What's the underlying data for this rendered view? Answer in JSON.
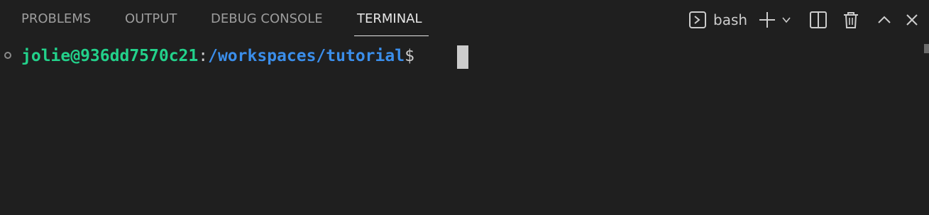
{
  "tabs": [
    {
      "label": "PROBLEMS",
      "active": false
    },
    {
      "label": "OUTPUT",
      "active": false
    },
    {
      "label": "DEBUG CONSOLE",
      "active": false
    },
    {
      "label": "TERMINAL",
      "active": true
    }
  ],
  "toolbar": {
    "shell_label": "bash",
    "icons": [
      "terminal-icon",
      "plus-icon",
      "chevron-down-icon",
      "split-icon",
      "trash-icon",
      "chevron-up-icon",
      "close-icon"
    ]
  },
  "terminal": {
    "user_host": "jolie@936dd7570c21",
    "separator": ":",
    "path": "/workspaces/tutorial",
    "prompt_symbol": "$"
  },
  "colors": {
    "background": "#1f1f1f",
    "user_host": "#23d18b",
    "path": "#3b8eea",
    "text": "#cccccc",
    "tab_inactive": "#9d9d9d",
    "tab_active": "#e7e7e7"
  }
}
